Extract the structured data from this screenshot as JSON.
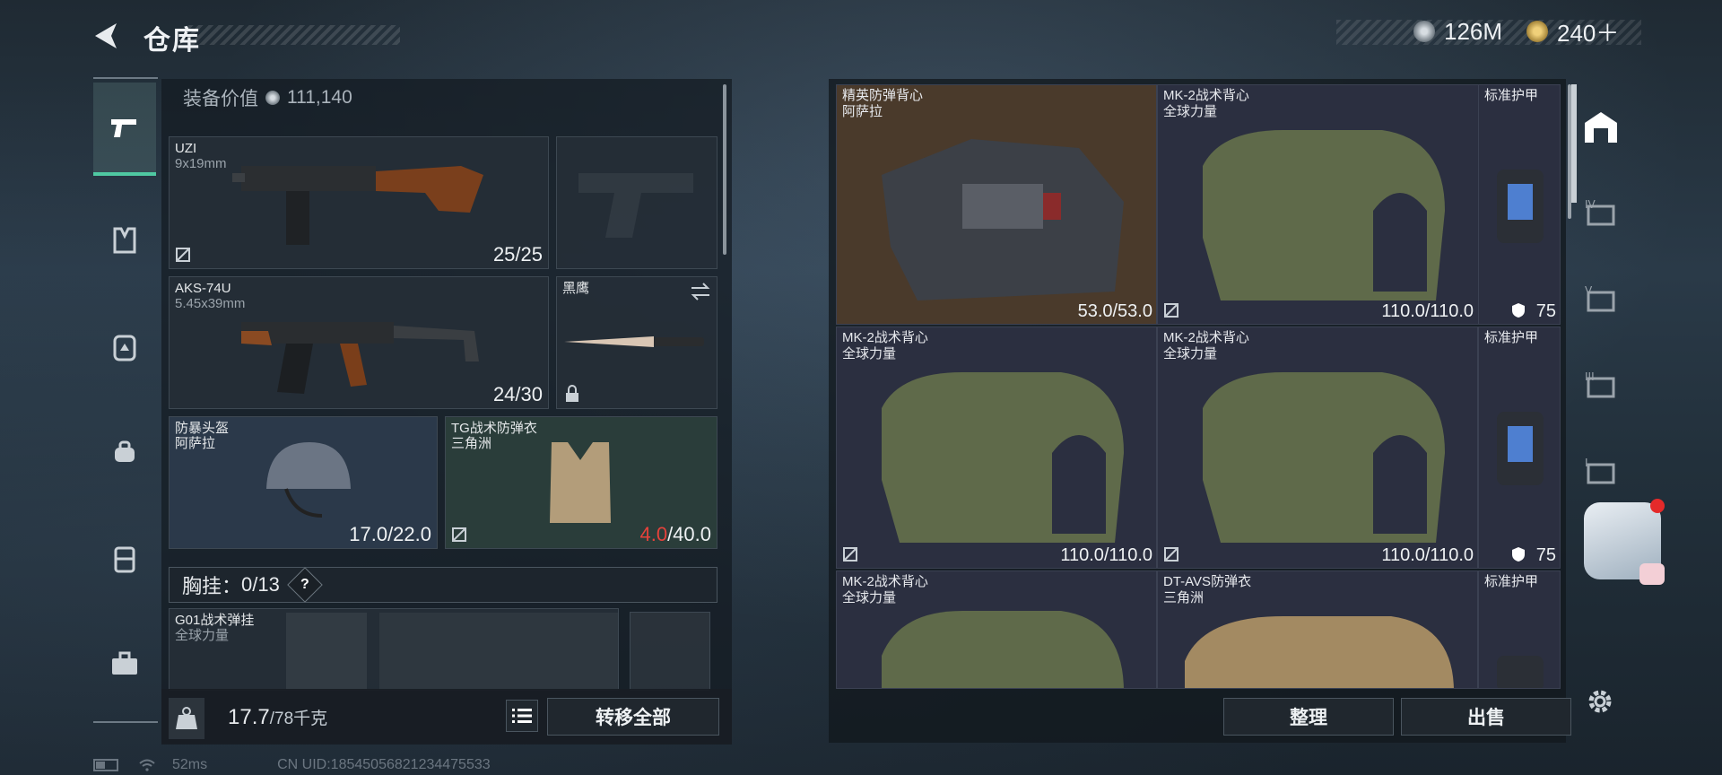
{
  "header": {
    "title": "仓库"
  },
  "currency": {
    "primary": "126M",
    "secondary": "240＋"
  },
  "left": {
    "equip_value_label": "装备价值",
    "equip_value": "111,140",
    "slots": {
      "primary": {
        "name": "UZI",
        "caliber": "9x19mm",
        "ammo": "25/25"
      },
      "pistol": {
        "name": "",
        "caliber": "",
        "ammo": ""
      },
      "secondary": {
        "name": "AKS-74U",
        "caliber": "5.45x39mm",
        "ammo": "24/30"
      },
      "melee": {
        "name": "黑鹰",
        "caliber": "",
        "ammo": ""
      },
      "helmet": {
        "name": "防暴头盔",
        "faction": "阿萨拉",
        "durability": "17.0/22.0"
      },
      "armor": {
        "name": "TG战术防弹衣",
        "faction": "三角洲",
        "durability_current": "4.0",
        "durability_max": "/40.0"
      }
    },
    "chest_rig": {
      "label": "胸挂：",
      "count": "0/13",
      "help": "?"
    },
    "rig_item": {
      "name": "G01战术弹挂",
      "faction": "全球力量"
    },
    "weight": {
      "value": "17.7",
      "max": "/78千克"
    },
    "transfer_all": "转移全部"
  },
  "right": {
    "items": [
      {
        "name": "精英防弹背心",
        "faction": "阿萨拉",
        "durability": "53.0/53.0"
      },
      {
        "name": "MK-2战术背心",
        "faction": "全球力量",
        "durability": "110.0/110.0"
      },
      {
        "name": "MK-2战术背心",
        "faction": "全球力量",
        "durability": "110.0/110.0"
      },
      {
        "name": "MK-2战术背心",
        "faction": "全球力量",
        "durability": "110.0/110.0"
      },
      {
        "name": "MK-2战术背心",
        "faction": "全球力量",
        "durability": ""
      },
      {
        "name": "DT-AVS防弹衣",
        "faction": "三角洲",
        "durability": ""
      }
    ],
    "side_items": [
      {
        "label": "标准护甲",
        "level": "75"
      },
      {
        "label": "标准护甲",
        "level": "75"
      },
      {
        "label": "标准护甲",
        "level": ""
      }
    ],
    "sort": "整理",
    "sell": "出售"
  },
  "status": {
    "ping": "52ms",
    "uid": "CN UID:18545056821234475533"
  },
  "colors": {
    "accent": "#4fc9a2",
    "warning": "#e5423b"
  }
}
